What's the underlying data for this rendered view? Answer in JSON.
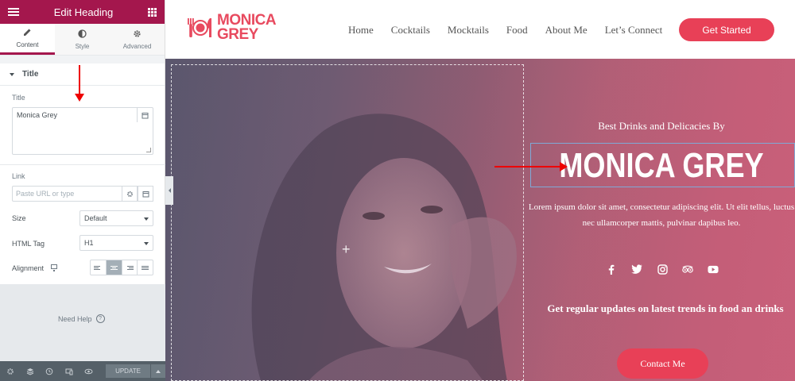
{
  "editor": {
    "panel_title": "Edit Heading",
    "tabs": [
      {
        "label": "Content",
        "icon": "pencil-icon",
        "active": true
      },
      {
        "label": "Style",
        "icon": "half-circle-icon",
        "active": false
      },
      {
        "label": "Advanced",
        "icon": "gear-icon",
        "active": false
      }
    ],
    "section_title": "Title",
    "title_label": "Title",
    "title_value": "Monica Grey",
    "link_label": "Link",
    "link_placeholder": "Paste URL or type",
    "size_label": "Size",
    "size_value": "Default",
    "html_tag_label": "HTML Tag",
    "html_tag_value": "H1",
    "alignment_label": "Alignment",
    "alignment_selected": "center",
    "need_help": "Need Help",
    "update_button": "UPDATE",
    "accent_color": "#a4174d"
  },
  "site": {
    "logo_line1": "MONICA",
    "logo_line2": "GREY",
    "nav": [
      "Home",
      "Cocktails",
      "Mocktails",
      "Food",
      "About Me",
      "Let’s Connect"
    ],
    "cta": "Get Started",
    "brand_color": "#e84057"
  },
  "hero": {
    "subheading": "Best Drinks and Delicacies By",
    "heading": "MONICA GREY",
    "body": "Lorem ipsum dolor sit amet, consectetur adipiscing elit. Ut elit tellus, luctus nec ullamcorper mattis, pulvinar dapibus leo.",
    "social_icons": [
      "facebook-icon",
      "twitter-icon",
      "instagram-icon",
      "tripadvisor-icon",
      "youtube-icon"
    ],
    "updates_text": "Get regular updates on latest trends in food an drinks",
    "contact_button": "Contact Me"
  }
}
